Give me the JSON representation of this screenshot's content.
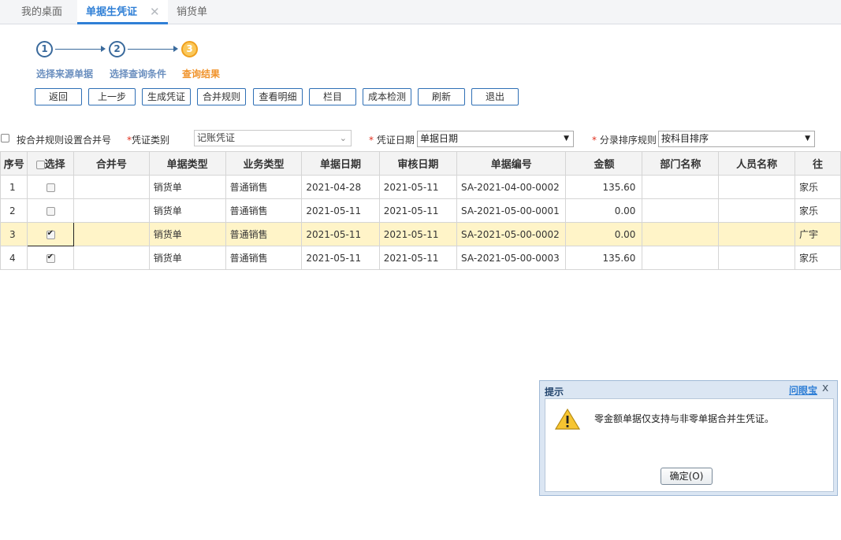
{
  "tabs": [
    {
      "label": "我的桌面"
    },
    {
      "label": "单据生凭证",
      "close": "✕"
    },
    {
      "label": "销货单"
    }
  ],
  "wizard": {
    "steps": [
      {
        "num": "1",
        "label": "选择来源单据"
      },
      {
        "num": "2",
        "label": "选择查询条件"
      },
      {
        "num": "3",
        "label": "查询结果"
      }
    ]
  },
  "toolbar": {
    "back": "返回",
    "prev": "上一步",
    "generate": "生成凭证",
    "merge_rules": "合并规则",
    "view_detail": "查看明细",
    "columns": "栏目",
    "cost_check": "成本检测",
    "refresh": "刷新",
    "exit": "退出"
  },
  "filters": {
    "merge_by_rule_label": "按合并规则设置合并号",
    "voucher_type_label": "凭证类别",
    "voucher_type_value": "记账凭证",
    "voucher_date_label": "凭证日期",
    "voucher_date_value": "单据日期",
    "entry_sort_label": "分录排序规则",
    "entry_sort_value": "按科目排序",
    "required_mark": "*"
  },
  "table": {
    "headers": [
      "序号",
      "选择",
      "合并号",
      "单据类型",
      "业务类型",
      "单据日期",
      "审核日期",
      "单据编号",
      "金额",
      "部门名称",
      "人员名称",
      "往"
    ],
    "rows": [
      {
        "idx": "1",
        "checked": false,
        "merge": "",
        "doc_type": "销货单",
        "biz_type": "普通销售",
        "doc_date": "2021-04-28",
        "audit_date": "2021-05-11",
        "doc_no": "SA-2021-04-00-0002",
        "amount": "135.60",
        "dept": "",
        "person": "",
        "partner": "家乐"
      },
      {
        "idx": "2",
        "checked": false,
        "merge": "",
        "doc_type": "销货单",
        "biz_type": "普通销售",
        "doc_date": "2021-05-11",
        "audit_date": "2021-05-11",
        "doc_no": "SA-2021-05-00-0001",
        "amount": "0.00",
        "dept": "",
        "person": "",
        "partner": "家乐"
      },
      {
        "idx": "3",
        "checked": true,
        "merge": "",
        "doc_type": "销货单",
        "biz_type": "普通销售",
        "doc_date": "2021-05-11",
        "audit_date": "2021-05-11",
        "doc_no": "SA-2021-05-00-0002",
        "amount": "0.00",
        "dept": "",
        "person": "",
        "partner": "广宇"
      },
      {
        "idx": "4",
        "checked": true,
        "merge": "",
        "doc_type": "销货单",
        "biz_type": "普通销售",
        "doc_date": "2021-05-11",
        "audit_date": "2021-05-11",
        "doc_no": "SA-2021-05-00-0003",
        "amount": "135.60",
        "dept": "",
        "person": "",
        "partner": "家乐"
      }
    ]
  },
  "dialog": {
    "title": "提示",
    "help_link": "问眼宝",
    "close": "x",
    "icon": "warning-icon",
    "message": "零金额单据仅支持与非零单据合并生凭证。",
    "ok_label": "确定(O)"
  },
  "colors": {
    "accent": "#2f7fd6",
    "step_active": "#f0932b",
    "selected_row": "#fff4c8"
  }
}
